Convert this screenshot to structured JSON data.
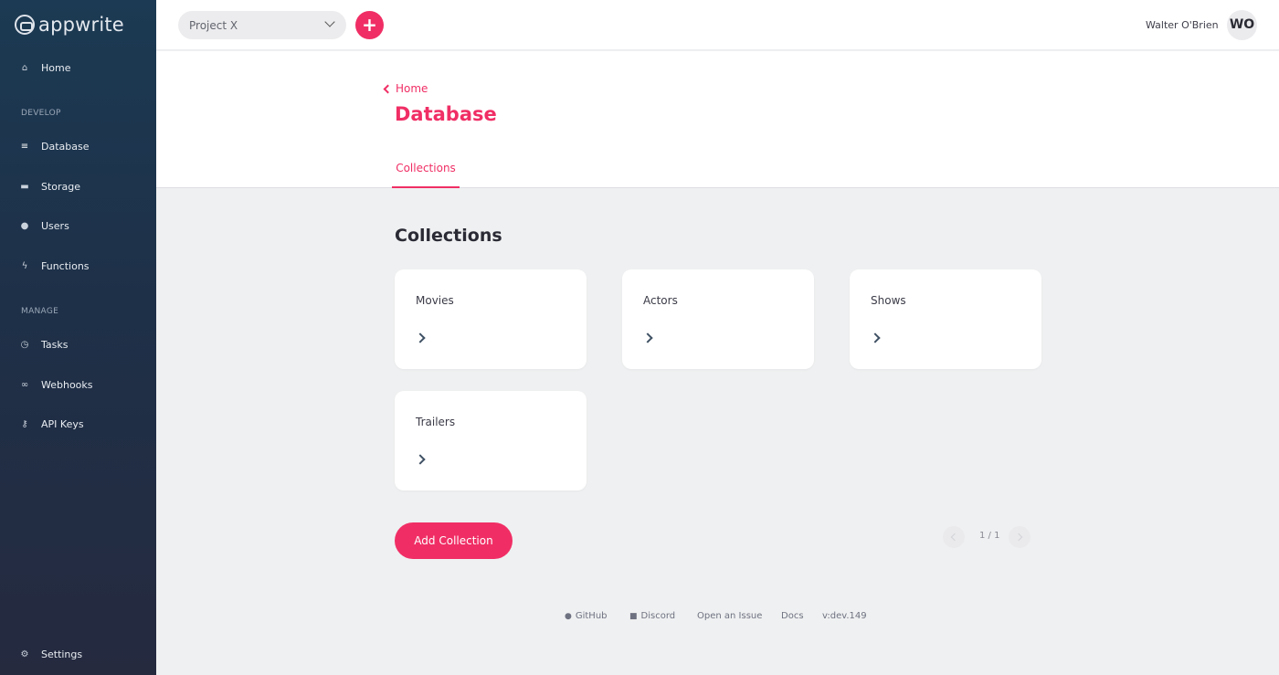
{
  "brand": {
    "name": "appwrite"
  },
  "sidebar": {
    "items": [
      {
        "label": "Home",
        "icon": "home-icon",
        "glyph": "⌂"
      },
      {
        "label": "Database",
        "icon": "database-icon",
        "glyph": "≡"
      },
      {
        "label": "Storage",
        "icon": "folder-icon",
        "glyph": "▬"
      },
      {
        "label": "Users",
        "icon": "users-icon",
        "glyph": "●"
      },
      {
        "label": "Functions",
        "icon": "bolt-icon",
        "glyph": "ϟ"
      },
      {
        "label": "Tasks",
        "icon": "clock-icon",
        "glyph": "◷"
      },
      {
        "label": "Webhooks",
        "icon": "link-icon",
        "glyph": "∞"
      },
      {
        "label": "API Keys",
        "icon": "key-icon",
        "glyph": "⚷"
      },
      {
        "label": "Settings",
        "icon": "gear-icon",
        "glyph": "⚙"
      }
    ],
    "sections": {
      "develop": "DEVELOP",
      "manage": "MANAGE"
    },
    "active": "Database"
  },
  "topbar": {
    "project": "Project X",
    "add_symbol": "+",
    "user_name": "Walter O'Brien",
    "avatar_initials": "WO"
  },
  "header": {
    "back_label": "Home",
    "title": "Database",
    "tabs": [
      {
        "label": "Collections"
      }
    ]
  },
  "main": {
    "section_title": "Collections",
    "collections": [
      {
        "name": "Movies"
      },
      {
        "name": "Actors"
      },
      {
        "name": "Shows"
      },
      {
        "name": "Trailers"
      }
    ],
    "add_button": "Add Collection",
    "pagination": "1 / 1"
  },
  "footer": {
    "github": "GitHub",
    "discord": "Discord",
    "issue": "Open an Issue",
    "docs": "Docs",
    "version": "v:dev.149"
  },
  "colors": {
    "accent": "#f02e65",
    "sidebar": "#1e3048",
    "background": "#eff0f1"
  }
}
